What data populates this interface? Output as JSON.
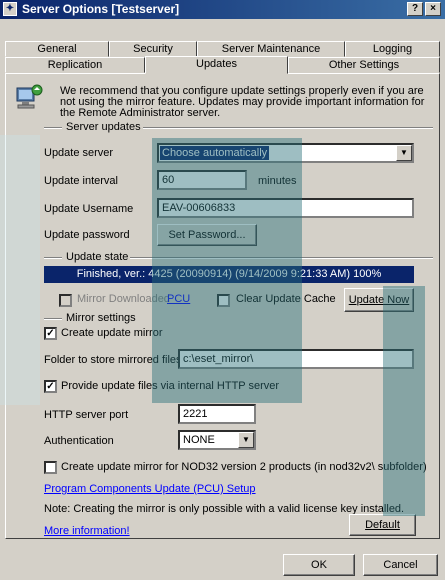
{
  "window": {
    "title": "Server Options [Testserver]",
    "help_btn": "?",
    "close_btn": "×"
  },
  "tabs_row1": [
    "General",
    "Security",
    "Server Maintenance",
    "Logging"
  ],
  "tabs_row2": [
    "Replication",
    "Updates",
    "Other Settings"
  ],
  "active_tab": "Updates",
  "info_text_1": "We recommend that you configure update settings properly even if you are",
  "info_text_2": "not using the mirror feature. Updates may provide important information for",
  "info_text_3": "the Remote Administrator server.",
  "server_updates": {
    "group_label": "Server updates",
    "update_server_label": "Update server",
    "update_server_value": "Choose automatically",
    "update_interval_label": "Update interval",
    "update_interval_value": "60",
    "minutes_label": "minutes",
    "username_label": "Update Username",
    "username_value": "EAV-00606833",
    "password_label": "Update password",
    "set_password_btn": "Set Password..."
  },
  "update_state": {
    "group_label": "Update state",
    "status": "Finished, ver.: 4425 (20090914)  (9/14/2009 9:21:33 AM) 100%",
    "mirror_downloaded_label": "Mirror Downloaded",
    "pcu_link": "PCU",
    "clear_cache_label": "Clear Update Cache",
    "update_now_btn": "Update Now"
  },
  "mirror": {
    "group_label": "Mirror settings",
    "create_mirror_label": "Create update mirror",
    "folder_label": "Folder to store mirrored files",
    "folder_value": "c:\\eset_mirror\\",
    "http_label": "Provide update files via internal HTTP server",
    "port_label": "HTTP server port",
    "port_value": "2221",
    "auth_label": "Authentication",
    "auth_value": "NONE",
    "nod32_label": "Create update mirror for NOD32 version 2 products (in nod32v2\\ subfolder)"
  },
  "pcu_setup_link": "Program Components Update (PCU) Setup",
  "note_text": "Note: Creating the mirror is only possible with a valid license key installed.",
  "more_info_link": "More information!",
  "default_btn": "Default",
  "ok_btn": "OK",
  "cancel_btn": "Cancel",
  "colors": {
    "titlebar": "#0a246a",
    "status_bar": "#0a246a",
    "selection": "#0a246a",
    "link": "#0000ff"
  }
}
